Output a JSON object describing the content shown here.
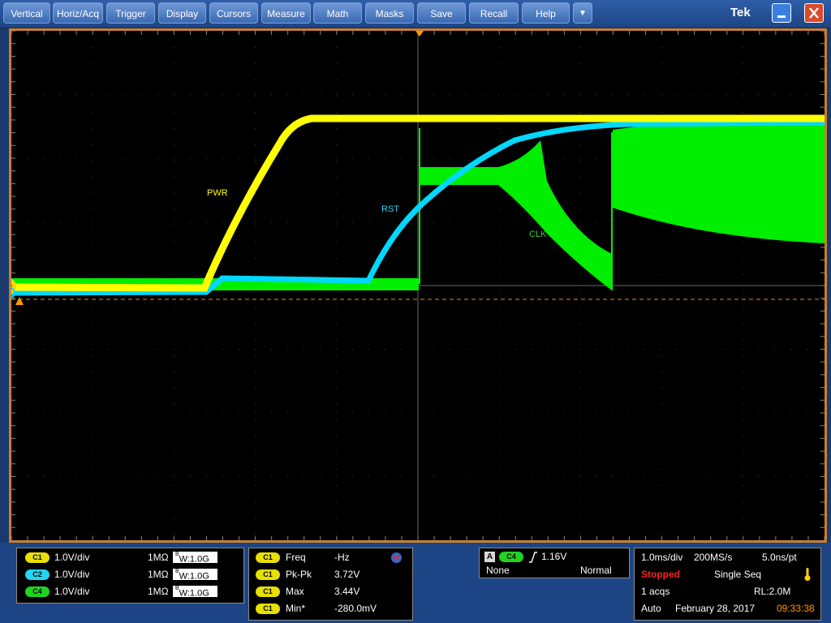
{
  "menu": {
    "items": [
      {
        "label": "Vertical"
      },
      {
        "label": "Horiz/Acq"
      },
      {
        "label": "Trigger"
      },
      {
        "label": "Display"
      },
      {
        "label": "Cursors"
      },
      {
        "label": "Measure"
      },
      {
        "label": "Math"
      },
      {
        "label": "Masks"
      },
      {
        "label": "Save"
      },
      {
        "label": "Recall"
      },
      {
        "label": "Help"
      }
    ],
    "more_icon": "▼",
    "brand": "Tek",
    "minimize_icon": "minimize-icon",
    "close_icon": "close-icon"
  },
  "waveform": {
    "labels": {
      "pwr": "PWR",
      "rst": "RST",
      "clk": "CLK"
    },
    "channel_marker": "1",
    "colors": {
      "ch1": "#ffff00",
      "ch2": "#00e5ff",
      "ch4": "#00ff00",
      "frame": "#c87f2e",
      "trigger": "#ff9900"
    }
  },
  "channels": [
    {
      "badge": "C1",
      "scale": "1.0V/div",
      "impedance": "1MΩ",
      "bw": "1.0G"
    },
    {
      "badge": "C2",
      "scale": "1.0V/div",
      "impedance": "1MΩ",
      "bw": "1.0G"
    },
    {
      "badge": "C4",
      "scale": "1.0V/div",
      "impedance": "1MΩ",
      "bw": "1.0G"
    }
  ],
  "bw_prefix": "B",
  "bw_sub": "W:",
  "measurements": [
    {
      "badge": "C1",
      "name": "Freq",
      "value": "-Hz"
    },
    {
      "badge": "C1",
      "name": "Pk-Pk",
      "value": "3.72V"
    },
    {
      "badge": "C1",
      "name": "Max",
      "value": "3.44V"
    },
    {
      "badge": "C1",
      "name": "Min*",
      "value": "-280.0mV"
    }
  ],
  "trigger": {
    "mode_badge": "A",
    "source": "C4",
    "level": "1.16V",
    "coupling": "None",
    "type": "Normal"
  },
  "acq": {
    "timebase": "1.0ms/div",
    "rate": "200MS/s",
    "resolution": "5.0ns/pt",
    "status": "Stopped",
    "mode": "Single Seq",
    "acqs": "1 acqs",
    "rl": "RL:2.0M",
    "run_mode": "Auto",
    "date": "February 28, 2017",
    "time": "09:33:38"
  }
}
